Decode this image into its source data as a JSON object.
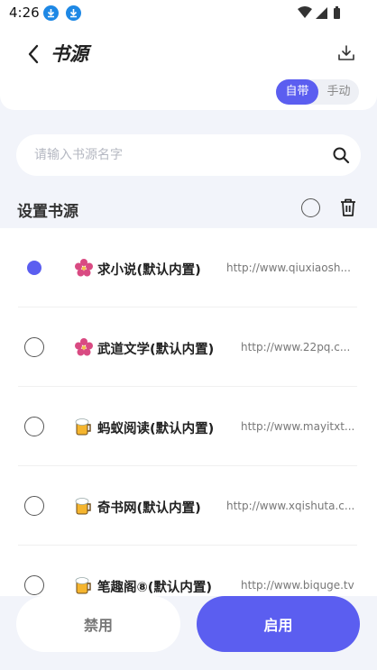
{
  "status_bar": {
    "time": "4:26"
  },
  "header": {
    "title": "书源"
  },
  "segment": {
    "builtin_label": "自带",
    "manual_label": "手动"
  },
  "search": {
    "placeholder": "请输入书源名字"
  },
  "section": {
    "title": "设置书源"
  },
  "sources": [
    {
      "name": "求小说(默认内置)",
      "url": "http://www.qiuxiaosh...",
      "selected": true,
      "icon": "flower-icon"
    },
    {
      "name": "武道文学(默认内置)",
      "url": "http://www.22pq.c...",
      "selected": false,
      "icon": "flower-icon"
    },
    {
      "name": "蚂蚁阅读(默认内置)",
      "url": "http://www.mayitxt...",
      "selected": false,
      "icon": "beer-icon"
    },
    {
      "name": "奇书网(默认内置)",
      "url": "http://www.xqishuta.c...",
      "selected": false,
      "icon": "beer-icon"
    },
    {
      "name": "笔趣阁⑧(默认内置)",
      "url": "http://www.biquge.tv",
      "selected": false,
      "icon": "beer-icon"
    }
  ],
  "buttons": {
    "disable_label": "禁用",
    "enable_label": "启用"
  },
  "colors": {
    "accent": "#5b5ef0",
    "background": "#f2f4fa"
  }
}
